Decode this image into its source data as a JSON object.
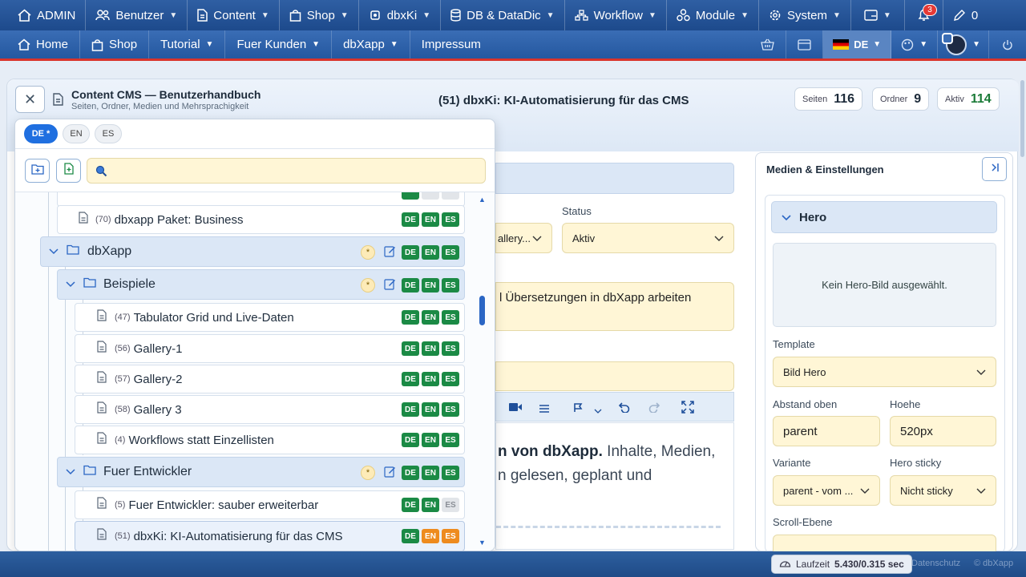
{
  "topbar": {
    "items": [
      {
        "label": "ADMIN",
        "icon": "home-icon"
      },
      {
        "label": "Benutzer",
        "icon": "users-icon"
      },
      {
        "label": "Content",
        "icon": "document-icon"
      },
      {
        "label": "Shop",
        "icon": "bag-icon"
      },
      {
        "label": "dbxKi",
        "icon": "chip-icon"
      },
      {
        "label": "DB & DataDic",
        "icon": "database-icon"
      },
      {
        "label": "Workflow",
        "icon": "sitemap-icon"
      },
      {
        "label": "Module",
        "icon": "cubes-icon"
      },
      {
        "label": "System",
        "icon": "gear-icon"
      }
    ],
    "notify_count": "3",
    "edit_count": "0"
  },
  "navbar": {
    "items": [
      {
        "label": "Home"
      },
      {
        "label": "Shop"
      },
      {
        "label": "Tutorial"
      },
      {
        "label": "Fuer Kunden"
      },
      {
        "label": "dbXapp"
      },
      {
        "label": "Impressum"
      }
    ],
    "lang": "DE"
  },
  "header": {
    "title": "Content CMS — Benutzerhandbuch",
    "subtitle": "Seiten, Ordner, Medien und Mehrsprachigkeit",
    "center_title": "(51) dbxKi: KI-Automatisierung für das CMS",
    "stats": [
      {
        "label": "Seiten",
        "value": "116"
      },
      {
        "label": "Ordner",
        "value": "9"
      },
      {
        "label": "Aktiv",
        "value": "114"
      }
    ]
  },
  "panel": {
    "langs": [
      "DE *",
      "EN",
      "ES"
    ],
    "rows": [
      {
        "num": "(70)",
        "label": "dbxapp Paket: Business",
        "langs": [
          "DE",
          "EN",
          "ES"
        ]
      },
      {
        "label": "dbXapp",
        "folder": true,
        "langs": [
          "DE",
          "EN",
          "ES"
        ]
      },
      {
        "label": "Beispiele",
        "folder": true,
        "langs": [
          "DE",
          "EN",
          "ES"
        ]
      },
      {
        "num": "(47)",
        "label": "Tabulator Grid und Live-Daten",
        "langs": [
          "DE",
          "EN",
          "ES"
        ]
      },
      {
        "num": "(56)",
        "label": "Gallery-1",
        "langs": [
          "DE",
          "EN",
          "ES"
        ]
      },
      {
        "num": "(57)",
        "label": "Gallery-2",
        "langs": [
          "DE",
          "EN",
          "ES"
        ]
      },
      {
        "num": "(58)",
        "label": "Gallery 3",
        "langs": [
          "DE",
          "EN",
          "ES"
        ]
      },
      {
        "num": "(4)",
        "label": "Workflows statt Einzellisten",
        "langs": [
          "DE",
          "EN",
          "ES"
        ]
      },
      {
        "label": "Fuer Entwickler",
        "folder": true,
        "langs": [
          "DE",
          "EN",
          "ES"
        ]
      },
      {
        "num": "(5)",
        "label": "Fuer Entwickler: sauber erweiterbar",
        "langs": [
          "DE",
          "EN",
          "ES"
        ]
      },
      {
        "num": "(51)",
        "label": "dbxKi: KI-Automatisierung für das CMS",
        "langs": [
          "DE",
          "EN",
          "ES"
        ]
      }
    ]
  },
  "editor": {
    "status_label": "Status",
    "status_value": "Aktiv",
    "select_partial": "allery...",
    "textarea_text": "l Übersetzungen in dbXapp arbeiten",
    "body_bold": "n von dbXapp.",
    "body_rest": " Inhalte, Medien,",
    "body_line2": "n gelesen, geplant und"
  },
  "right": {
    "title": "Medien & Einstellungen",
    "hero": "Hero",
    "no_image": "Kein Hero-Bild ausgewählt.",
    "template_label": "Template",
    "template_value": "Bild Hero",
    "abstand_label": "Abstand oben",
    "abstand_value": "parent",
    "hoehe_label": "Hoehe",
    "hoehe_value": "520px",
    "variante_label": "Variante",
    "variante_value": "parent - vom ...",
    "sticky_label": "Hero sticky",
    "sticky_value": "Nicht sticky",
    "scroll_label": "Scroll-Ebene"
  },
  "footer": {
    "runtime_label": "Laufzeit",
    "runtime_value": "5.430/0.315 sec",
    "datenschutz": "Datenschutz",
    "copyright": "© dbXapp"
  },
  "colors": {
    "accent": "#1f6fe0",
    "lang_green": "#1b8a45",
    "lang_orange": "#ee8b1e",
    "field_bg": "#fff6d6"
  }
}
